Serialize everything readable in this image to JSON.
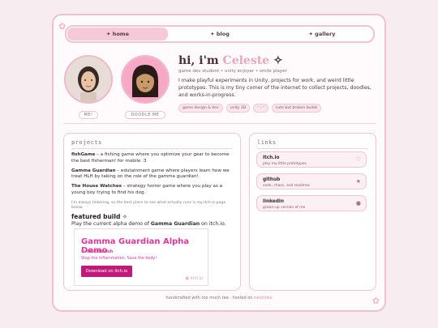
{
  "nav": {
    "tabs": [
      {
        "label": "✦ home",
        "active": true
      },
      {
        "label": "✦ blog",
        "active": false
      },
      {
        "label": "✦ gallery",
        "active": false
      }
    ]
  },
  "avatars": [
    {
      "label": "ME!"
    },
    {
      "label": "DOODLE ME"
    }
  ],
  "hero": {
    "greeting": "hi, i'm",
    "name": "Celeste",
    "sparkle": "✧",
    "subtitle": "game dev student • unity enjoyer • smile player",
    "description": "I make playful experiments in Unity, projects for work, and weird little prototypes. This is my tiny corner of the internet to collect projects, doodles, and works-in-progress.",
    "tags": [
      "game design & dev",
      "unity 3D",
      "ᵔ ᵕ ᵔ",
      "cute but broken builds"
    ]
  },
  "projects": {
    "title": "projects",
    "items": [
      {
        "name": "fishGame",
        "desc": " – a fishing game where you optimize your gear to become the best fisherman! for mobile :3"
      },
      {
        "name": "Gamma Guardian",
        "desc": " – edutainment game where players learn how we treat HLH by taking on the role of the gamma guardian!"
      },
      {
        "name": "The House Watches",
        "desc": " – strategy horror game where you play as a young boy trying to find his dog."
      }
    ],
    "note": "I'm always tinkering, so the best place to see what actually runs is my itch.io page below.",
    "featured_heading": "featured build ✧",
    "featured_sub_prefix": "Play the current alpha demo of ",
    "featured_sub_bold": "Gamma Guardian",
    "featured_sub_suffix": " on itch.io."
  },
  "itch_widget": {
    "title": "Gamma Guardian Alpha Demo",
    "by_prefix": "by ",
    "author": "celestewish",
    "tagline": "Stop the inflammation. Save the body!",
    "button": "Download on itch.io",
    "brand": "itch.io"
  },
  "links": {
    "title": "links",
    "items": [
      {
        "name": "itch.io",
        "desc": "play my little prototypes",
        "icon": "♡",
        "icon_name": "heart-icon"
      },
      {
        "name": "github",
        "desc": "code, chaos, and readmes",
        "icon": "★",
        "icon_name": "star-icon"
      },
      {
        "name": "linkedin",
        "desc": "grown-up version of me",
        "icon": "●",
        "icon_name": "dot-icon"
      }
    ]
  },
  "footer": {
    "text": "handcrafted with too much tea · hosted on ",
    "host": "neocities"
  },
  "colors": {
    "accent_pink": "#f6c9d8",
    "itch_magenta": "#e0369a",
    "button_magenta": "#c2187a"
  }
}
